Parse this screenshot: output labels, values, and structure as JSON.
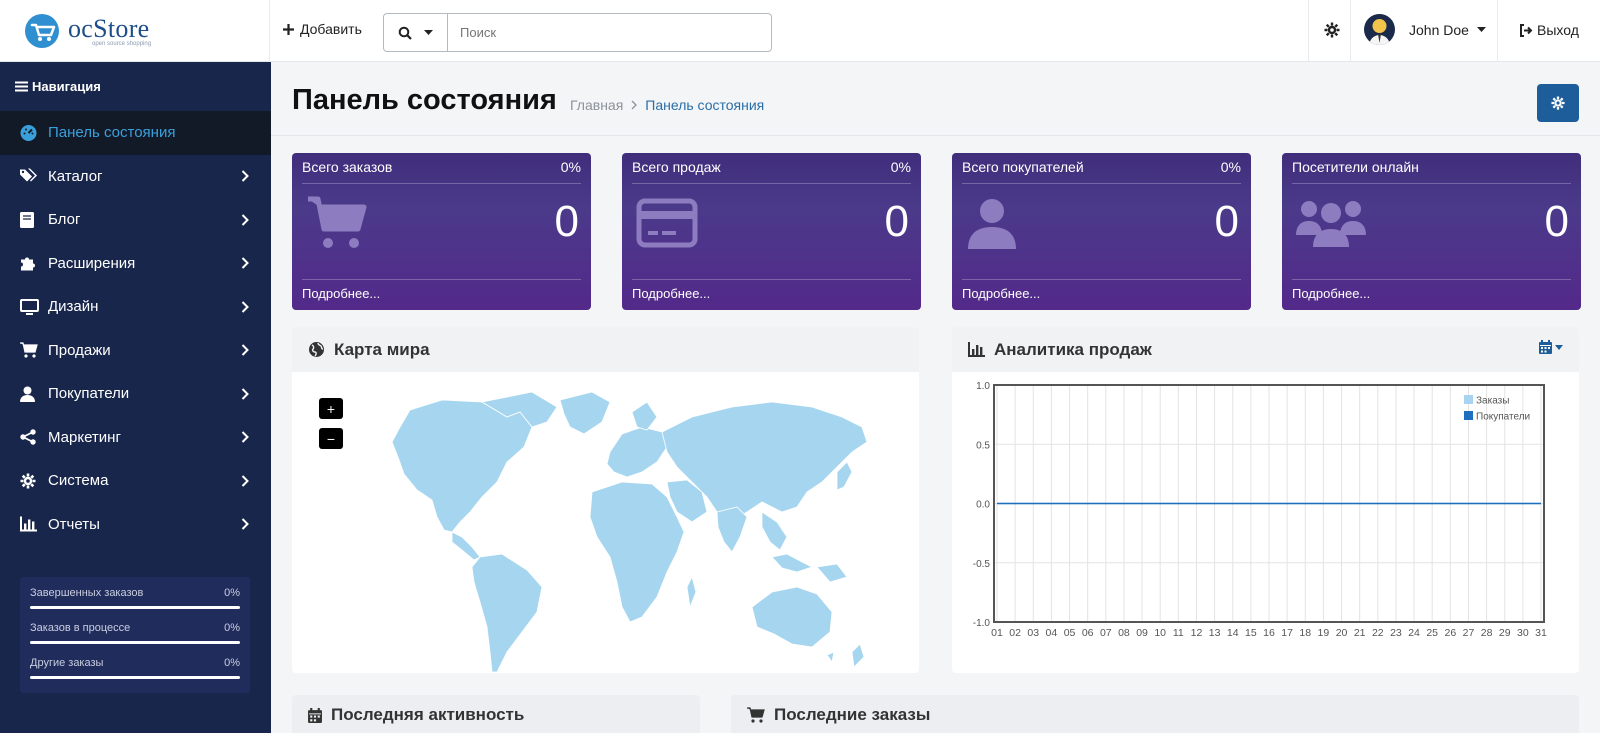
{
  "header": {
    "logo_name": "ocStore",
    "logo_tagline": "open source shopping",
    "add_label": "Добавить",
    "search_placeholder": "Поиск",
    "user_name": "John Doe",
    "logout_label": "Выход"
  },
  "sidebar": {
    "nav_title": "Навигация",
    "items": [
      {
        "label": "Панель состояния",
        "icon": "dashboard-icon",
        "active": true
      },
      {
        "label": "Каталог",
        "icon": "tags-icon"
      },
      {
        "label": "Блог",
        "icon": "book-icon"
      },
      {
        "label": "Расширения",
        "icon": "puzzle-icon"
      },
      {
        "label": "Дизайн",
        "icon": "monitor-icon"
      },
      {
        "label": "Продажи",
        "icon": "cart-icon"
      },
      {
        "label": "Покупатели",
        "icon": "user-icon"
      },
      {
        "label": "Маркетинг",
        "icon": "share-icon"
      },
      {
        "label": "Система",
        "icon": "gear-icon"
      },
      {
        "label": "Отчеты",
        "icon": "bar-chart-icon"
      }
    ],
    "stats": [
      {
        "label": "Завершенных заказов",
        "percent": "0%"
      },
      {
        "label": "Заказов в процессе",
        "percent": "0%"
      },
      {
        "label": "Другие заказы",
        "percent": "0%"
      }
    ]
  },
  "page": {
    "title": "Панель состояния",
    "breadcrumb_home": "Главная",
    "breadcrumb_current": "Панель состояния"
  },
  "tiles": [
    {
      "title": "Всего заказов",
      "percent": "0%",
      "value": "0",
      "more": "Подробнее...",
      "icon": "cart-icon"
    },
    {
      "title": "Всего продаж",
      "percent": "0%",
      "value": "0",
      "more": "Подробнее...",
      "icon": "credit-card-icon"
    },
    {
      "title": "Всего покупателей",
      "percent": "0%",
      "value": "0",
      "more": "Подробнее...",
      "icon": "user-icon"
    },
    {
      "title": "Посетители онлайн",
      "percent": "",
      "value": "0",
      "more": "Подробнее...",
      "icon": "users-icon"
    }
  ],
  "map_card": {
    "title": "Карта мира",
    "zoom_in": "+",
    "zoom_out": "−"
  },
  "sales_card": {
    "title": "Аналитика продаж"
  },
  "activity_card": {
    "title": "Последняя активность"
  },
  "orders_card": {
    "title": "Последние заказы"
  },
  "colors": {
    "sidebar": "#18264b",
    "accent": "#1d5d9a",
    "active_text": "#3aa0dc",
    "map_land": "#a6d6ef"
  },
  "chart_data": {
    "type": "line",
    "x": [
      "01",
      "02",
      "03",
      "04",
      "05",
      "06",
      "07",
      "08",
      "09",
      "10",
      "11",
      "12",
      "13",
      "14",
      "15",
      "16",
      "17",
      "18",
      "19",
      "20",
      "21",
      "22",
      "23",
      "24",
      "25",
      "26",
      "27",
      "28",
      "29",
      "30",
      "31"
    ],
    "ylim": [
      -1.0,
      1.0
    ],
    "yticks": [
      "1.0",
      "0.5",
      "0.0",
      "-0.5",
      "-1.0"
    ],
    "series": [
      {
        "name": "Заказы",
        "color": "#a8d4f2",
        "values": [
          0,
          0,
          0,
          0,
          0,
          0,
          0,
          0,
          0,
          0,
          0,
          0,
          0,
          0,
          0,
          0,
          0,
          0,
          0,
          0,
          0,
          0,
          0,
          0,
          0,
          0,
          0,
          0,
          0,
          0,
          0
        ]
      },
      {
        "name": "Покупатели",
        "color": "#1f6fbf",
        "values": [
          0,
          0,
          0,
          0,
          0,
          0,
          0,
          0,
          0,
          0,
          0,
          0,
          0,
          0,
          0,
          0,
          0,
          0,
          0,
          0,
          0,
          0,
          0,
          0,
          0,
          0,
          0,
          0,
          0,
          0,
          0
        ]
      }
    ],
    "legend_position": "top-right",
    "grid": true
  }
}
